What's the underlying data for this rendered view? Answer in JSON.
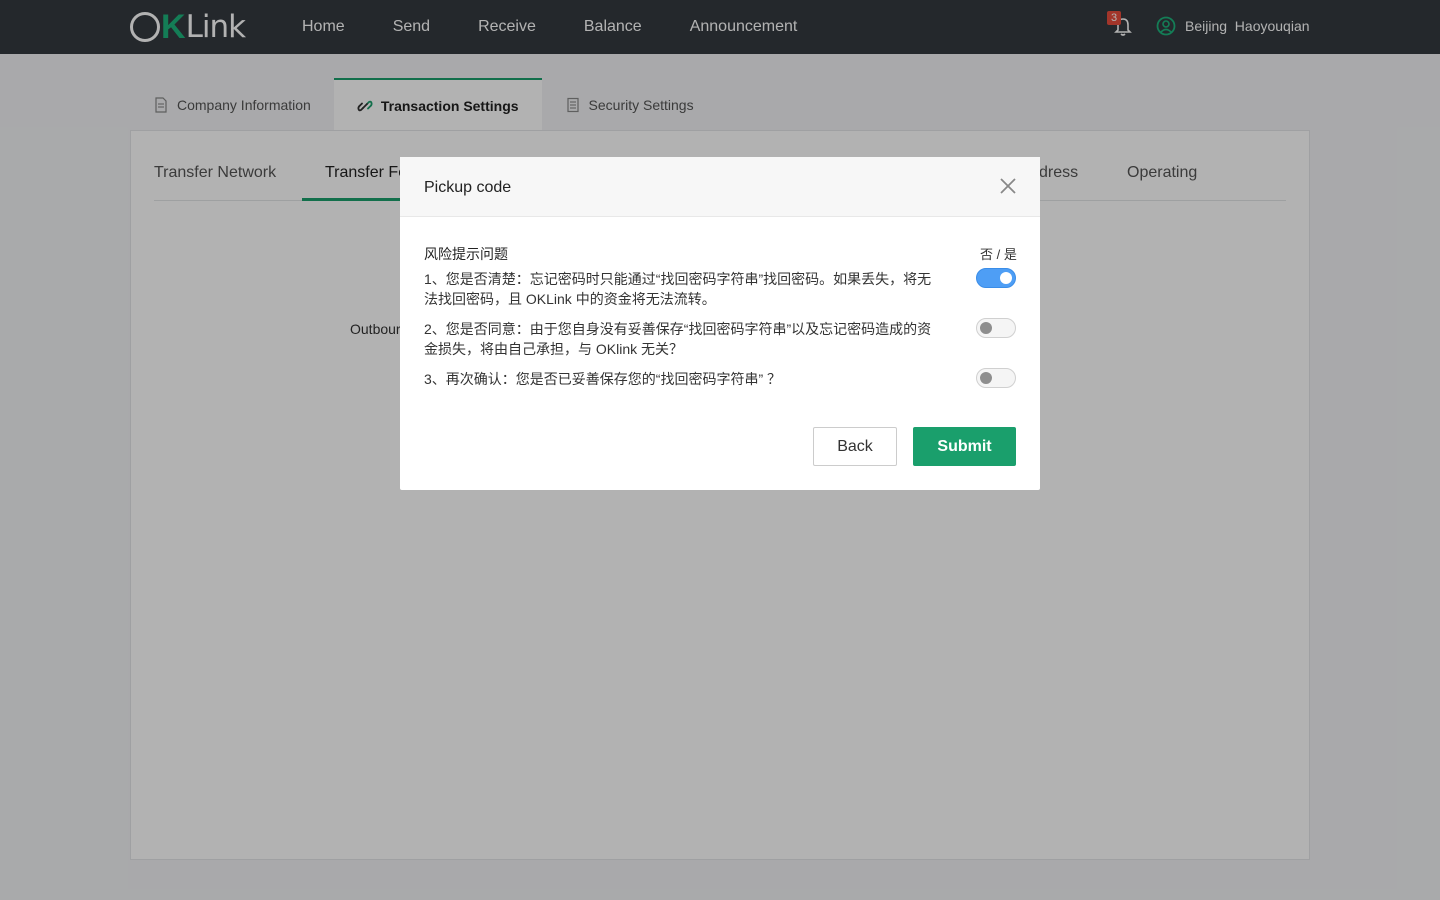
{
  "header": {
    "logo_o": "O",
    "logo_k": "K",
    "logo_link": "Link",
    "nav": [
      "Home",
      "Send",
      "Receive",
      "Balance",
      "Announcement"
    ],
    "notification_count": "3",
    "user_name": "Beijing  Haoyouqian"
  },
  "top_tabs": [
    {
      "label": "Company Information",
      "icon": "document-icon",
      "active": false
    },
    {
      "label": "Transaction Settings",
      "icon": "link-icon",
      "active": true
    },
    {
      "label": "Security Settings",
      "icon": "clipboard-icon",
      "active": false
    }
  ],
  "sub_tabs": [
    {
      "label": "Transfer Network",
      "active": false
    },
    {
      "label": "Transfer Fe",
      "active": true
    },
    {
      "label": "dress",
      "active": false
    },
    {
      "label": "Operating",
      "active": false
    }
  ],
  "content": {
    "outbound_label": "Outbour"
  },
  "modal": {
    "title": "Pickup code",
    "questions_header": "风险提示问题",
    "yes_no_label": "否 / 是",
    "questions": [
      {
        "text": "1、您是否清楚：忘记密码时只能通过“找回密码字符串”找回密码。如果丢失，将无法找回密码，且 OKLink 中的资金将无法流转。",
        "answer_yes": true
      },
      {
        "text": "2、您是否同意：由于您自身没有妥善保存“找回密码字符串”以及忘记密码造成的资金损失，将由自己承担，与 OKlink 无关？",
        "answer_yes": false
      },
      {
        "text": "3、再次确认：您是否已妥善保存您的“找回密码字符串” ？",
        "answer_yes": false
      }
    ],
    "back_label": "Back",
    "submit_label": "Submit"
  },
  "colors": {
    "header_bg": "#343a40",
    "accent_green": "#1a9f6c",
    "toggle_on_blue": "#4e9ef5",
    "badge_red": "#e84c3d"
  }
}
